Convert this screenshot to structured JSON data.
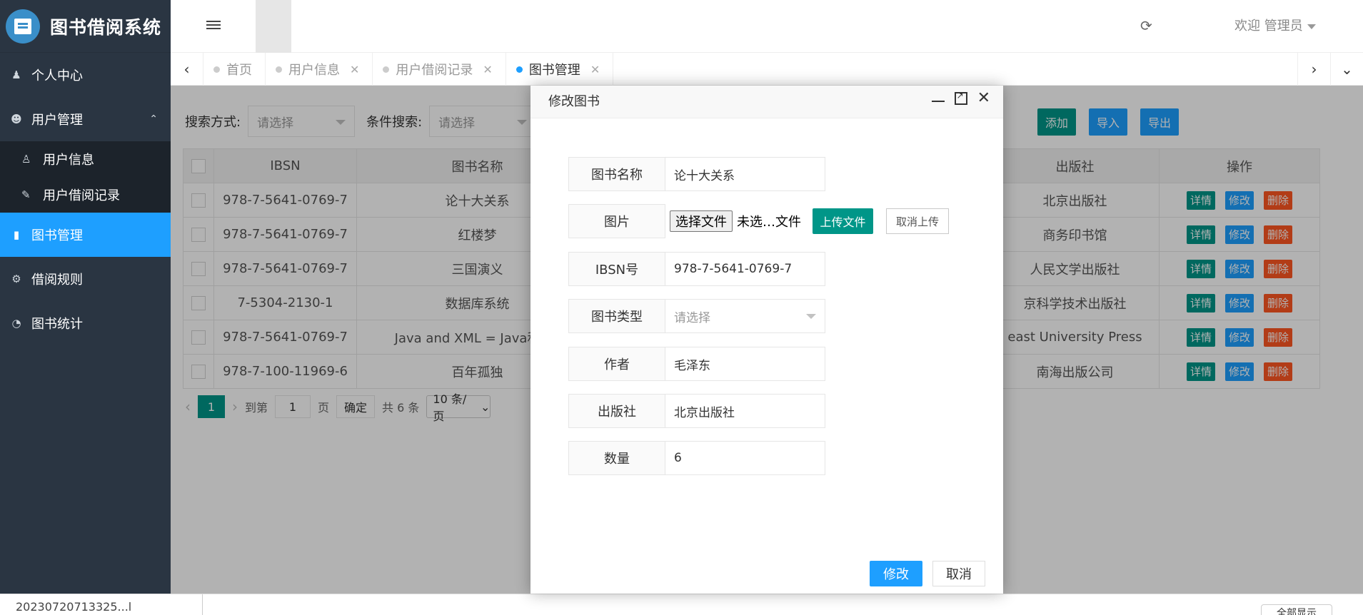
{
  "app": {
    "title": "图书借阅系统"
  },
  "sidebar": {
    "items": [
      {
        "label": "个人中心",
        "icon": "user-icon"
      },
      {
        "label": "用户管理",
        "icon": "users-icon",
        "expanded": true
      },
      {
        "label": "图书管理",
        "icon": "book-icon",
        "active": true
      },
      {
        "label": "借阅规则",
        "icon": "gears-icon"
      },
      {
        "label": "图书统计",
        "icon": "pie-chart-icon"
      }
    ],
    "sub_items": [
      {
        "label": "用户信息",
        "icon": "user-info-icon"
      },
      {
        "label": "用户借阅记录",
        "icon": "edit-icon"
      }
    ]
  },
  "header": {
    "welcome": "欢迎 管理员"
  },
  "tabs": [
    {
      "label": "首页",
      "closable": false
    },
    {
      "label": "用户信息",
      "closable": true
    },
    {
      "label": "用户借阅记录",
      "closable": true
    },
    {
      "label": "图书管理",
      "closable": true,
      "active": true
    }
  ],
  "search": {
    "mode_label": "搜索方式:",
    "mode_placeholder": "请选择",
    "cond_label": "条件搜索:",
    "cond_placeholder": "请选择"
  },
  "toolbar": {
    "add": "添加",
    "import": "导入",
    "export": "导出"
  },
  "table": {
    "columns": [
      "IBSN",
      "图书名称",
      "出版社",
      "操作"
    ],
    "rows": [
      {
        "ibsn": "978-7-5641-0769-7",
        "name": "论十大关系",
        "publisher": "北京出版社"
      },
      {
        "ibsn": "978-7-5641-0769-7",
        "name": "红楼梦",
        "publisher": "商务印书馆"
      },
      {
        "ibsn": "978-7-5641-0769-7",
        "name": "三国演义",
        "publisher": "人民文学出版社"
      },
      {
        "ibsn": "7-5304-2130-1",
        "name": "数据库系统",
        "publisher": "京科学技术出版社"
      },
      {
        "ibsn": "978-7-5641-0769-7",
        "name": "Java and XML = Java和XM",
        "publisher": "east University Press"
      },
      {
        "ibsn": "978-7-100-11969-6",
        "name": "百年孤独",
        "publisher": "南海出版公司"
      }
    ],
    "actions": {
      "detail": "详情",
      "edit": "修改",
      "delete": "删除"
    }
  },
  "pager": {
    "current": "1",
    "goto": "到第",
    "page_input": "1",
    "page": "页",
    "confirm": "确定",
    "total": "共 6 条",
    "per_page": "10 条/页"
  },
  "modal": {
    "title": "修改图书",
    "fields": {
      "name_label": "图书名称",
      "name_value": "论十大关系",
      "image_label": "图片",
      "file_button": "选择文件",
      "file_none": "未选…文件",
      "upload": "上传文件",
      "cancel_upload": "取消上传",
      "ibsn_label": "IBSN号",
      "ibsn_value": "978-7-5641-0769-7",
      "type_label": "图书类型",
      "type_placeholder": "请选择",
      "author_label": "作者",
      "author_value": "毛泽东",
      "publisher_label": "出版社",
      "publisher_value": "北京出版社",
      "qty_label": "数量",
      "qty_value": "6"
    },
    "ok": "修改",
    "cancel": "取消"
  },
  "bottom": {
    "file": "20230720713325...l",
    "show_all": "全部显示"
  },
  "colors": {
    "sidebar": "#2a3542",
    "active": "#1e9fff",
    "green": "#009688",
    "red": "#ff5722"
  }
}
